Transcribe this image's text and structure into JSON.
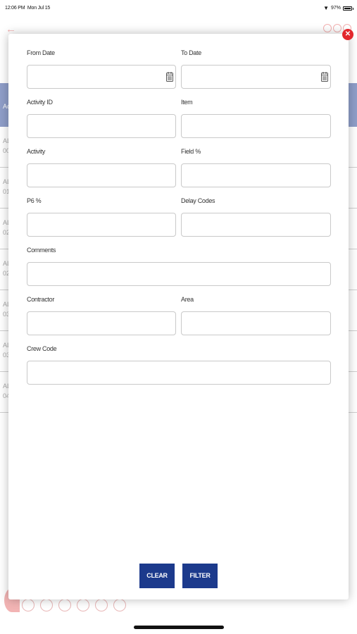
{
  "status_bar": {
    "time": "12:06 PM",
    "date": "Mon Jul 15",
    "battery_text": "97%",
    "battery_level": 0.97
  },
  "background": {
    "header_text": "Ac",
    "rows": [
      {
        "line1": "AL",
        "line2": "00"
      },
      {
        "line1": "AL",
        "line2": "01"
      },
      {
        "line1": "AL",
        "line2": "02"
      },
      {
        "line1": "AL",
        "line2": "02"
      },
      {
        "line1": "AL",
        "line2": "03"
      },
      {
        "line1": "AL",
        "line2": "03"
      },
      {
        "line1": "AL",
        "line2": "04"
      }
    ]
  },
  "modal": {
    "close_icon": "close-icon",
    "fields": {
      "from_date": {
        "label": "From Date",
        "value": ""
      },
      "to_date": {
        "label": "To Date",
        "value": ""
      },
      "activity_id": {
        "label": "Activity ID",
        "value": ""
      },
      "item": {
        "label": "Item",
        "value": ""
      },
      "activity": {
        "label": "Activity",
        "value": ""
      },
      "field_pct": {
        "label": "Field %",
        "value": ""
      },
      "p6_pct": {
        "label": "P6 %",
        "value": ""
      },
      "delay_codes": {
        "label": "Delay Codes",
        "value": ""
      },
      "comments": {
        "label": "Comments",
        "value": ""
      },
      "contractor": {
        "label": "Contractor",
        "value": ""
      },
      "area": {
        "label": "Area",
        "value": ""
      },
      "crew_code": {
        "label": "Crew Code",
        "value": ""
      }
    },
    "buttons": {
      "clear": "CLEAR",
      "filter": "FILTER"
    }
  },
  "colors": {
    "primary_button": "#1c3a8c",
    "close_button": "#e2262c",
    "background_header": "#8f9ec9"
  }
}
